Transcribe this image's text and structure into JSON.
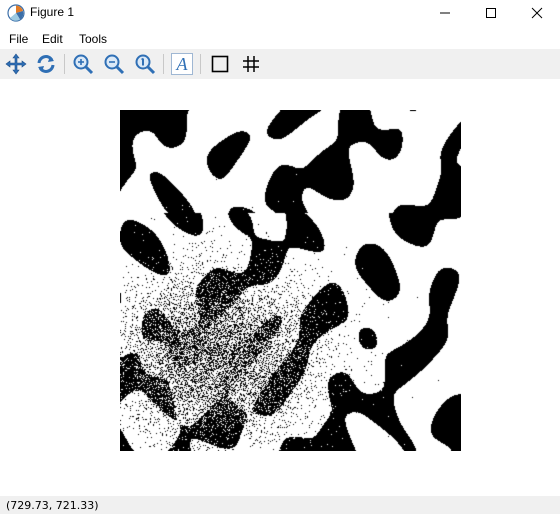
{
  "window": {
    "title": "Figure 1",
    "app_icon": "matplotlib-icon",
    "controls": [
      "minimize-icon",
      "maximize-icon",
      "close-icon"
    ]
  },
  "menu": {
    "items": [
      {
        "label": "File"
      },
      {
        "label": "Edit"
      },
      {
        "label": "Tools"
      }
    ]
  },
  "toolbar": {
    "buttons": [
      {
        "icon": "pan-icon"
      },
      {
        "icon": "refresh-icon"
      },
      {
        "icon": "zoom-in-icon"
      },
      {
        "icon": "zoom-out-icon"
      },
      {
        "icon": "zoom-fit-icon"
      },
      {
        "icon": "text-icon"
      },
      {
        "icon": "rectangle-icon"
      },
      {
        "icon": "grid-icon"
      }
    ]
  },
  "figure": {
    "content": "binary-noise-image",
    "colors": {
      "foreground": "#000000",
      "background": "#ffffff"
    }
  },
  "status": {
    "coordinates": "(729.73, 721.33)"
  },
  "colors": {
    "toolbar_bg": "#f0f0f0",
    "window_bg": "#ffffff",
    "icon_blue": "#2f6fb5"
  }
}
